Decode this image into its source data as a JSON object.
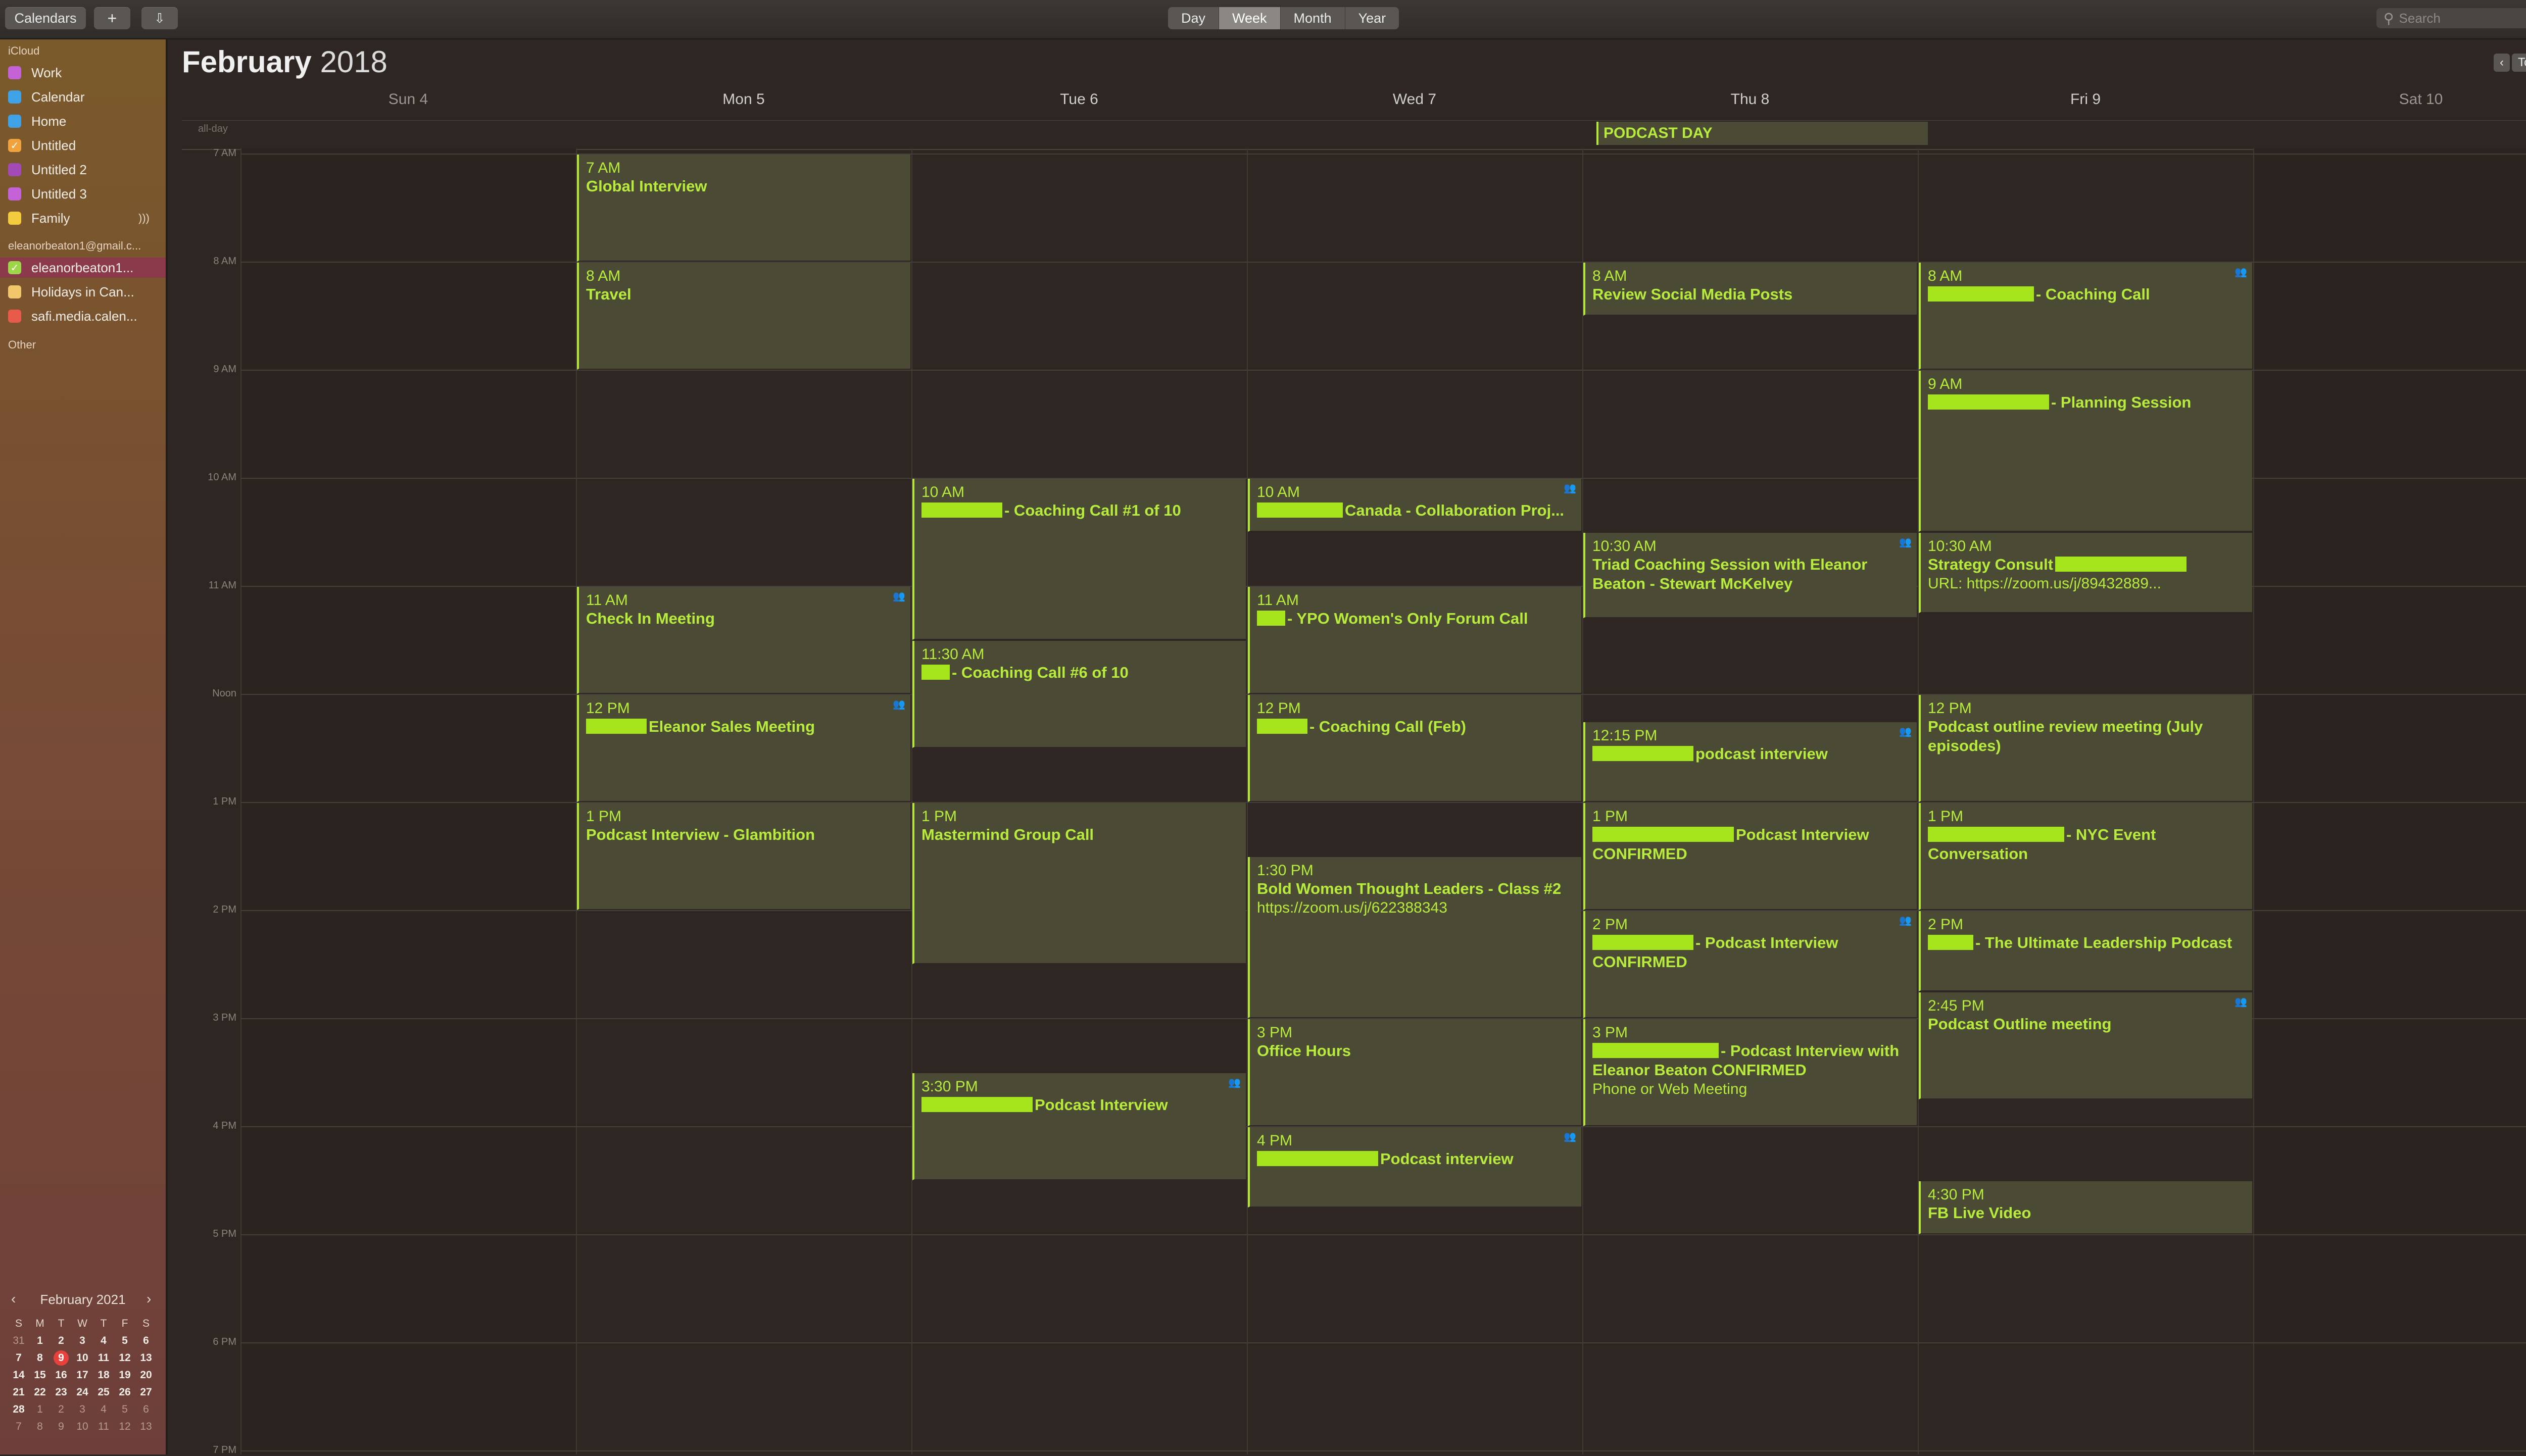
{
  "toolbar": {
    "calendars_label": "Calendars",
    "add_label": "+",
    "import_label": "⇩",
    "views": [
      "Day",
      "Week",
      "Month",
      "Year"
    ],
    "selected_view": "Week",
    "search_placeholder": "Search"
  },
  "sidebar": {
    "icloud_title": "iCloud",
    "icloud": [
      {
        "label": "Work",
        "color": "#c262d6"
      },
      {
        "label": "Calendar",
        "color": "#3fa2e6"
      },
      {
        "label": "Home",
        "color": "#3fa2e6"
      },
      {
        "label": "Untitled",
        "color": "#f0a23c",
        "checked": true
      },
      {
        "label": "Untitled 2",
        "color": "#a24ab6"
      },
      {
        "label": "Untitled 3",
        "color": "#c262d6"
      },
      {
        "label": "Family",
        "color": "#f2cc3c"
      }
    ],
    "gmail_title": "eleanorbeaton1@gmail.c...",
    "gmail": [
      {
        "label": "eleanorbeaton1...",
        "color": "#9ed64a",
        "checked": true,
        "selected": true
      },
      {
        "label": "Holidays in Can...",
        "color": "#f2c66a"
      },
      {
        "label": "safi.media.calen...",
        "color": "#e85a4a"
      }
    ],
    "other_title": "Other"
  },
  "mini_calendar": {
    "title": "February 2021",
    "prev": "‹",
    "next": "›",
    "dow": [
      "S",
      "M",
      "T",
      "W",
      "T",
      "F",
      "S"
    ],
    "days": [
      [
        "31",
        "1",
        "2",
        "3",
        "4",
        "5",
        "6"
      ],
      [
        "7",
        "8",
        "9",
        "10",
        "11",
        "12",
        "13"
      ],
      [
        "14",
        "15",
        "16",
        "17",
        "18",
        "19",
        "20"
      ],
      [
        "21",
        "22",
        "23",
        "24",
        "25",
        "26",
        "27"
      ],
      [
        "28",
        "1",
        "2",
        "3",
        "4",
        "5",
        "6"
      ],
      [
        "7",
        "8",
        "9",
        "10",
        "11",
        "12",
        "13"
      ]
    ],
    "today": "9"
  },
  "header": {
    "month": "February",
    "year": "2018",
    "prev": "‹",
    "today": "Today",
    "next": "›",
    "all_day_label": "all-day"
  },
  "days": [
    "Sun 4",
    "Mon 5",
    "Tue 6",
    "Wed 7",
    "Thu 8",
    "Fri 9",
    "Sat 10"
  ],
  "hours": [
    "7 AM",
    "8 AM",
    "9 AM",
    "10 AM",
    "11 AM",
    "Noon",
    "1 PM",
    "2 PM",
    "3 PM",
    "4 PM",
    "5 PM",
    "6 PM",
    "7 PM"
  ],
  "allday_event": "PODCAST DAY",
  "events": [
    {
      "day": 1,
      "start": 7,
      "end": 8,
      "time": "7 AM",
      "name": "Global Interview"
    },
    {
      "day": 1,
      "start": 8,
      "end": 9,
      "time": "8 AM",
      "name": "Travel"
    },
    {
      "day": 1,
      "start": 11,
      "end": 12,
      "time": "11 AM",
      "name": "Check In Meeting",
      "people": true
    },
    {
      "day": 1,
      "start": 12,
      "end": 13,
      "time": "12 PM",
      "redact": 120,
      "name": "Eleanor Sales Meeting",
      "people": true
    },
    {
      "day": 1,
      "start": 13,
      "end": 14,
      "time": "1 PM",
      "name": "Podcast Interview - Glambition"
    },
    {
      "day": 2,
      "start": 10,
      "end": 11.5,
      "time": "10 AM",
      "redact": 160,
      "name": "- Coaching Call #1 of 10"
    },
    {
      "day": 2,
      "start": 11.5,
      "end": 12.5,
      "time": "11:30 AM",
      "redact": 56,
      "name": "- Coaching Call #6 of 10"
    },
    {
      "day": 2,
      "start": 13,
      "end": 14.5,
      "time": "1 PM",
      "name": "Mastermind Group Call"
    },
    {
      "day": 2,
      "start": 15.5,
      "end": 16.5,
      "time": "3:30 PM",
      "redact": 220,
      "name": "Podcast Interview",
      "people": true
    },
    {
      "day": 3,
      "start": 10,
      "end": 10.5,
      "time": "10 AM",
      "redact": 170,
      "name": "Canada - Collaboration Proj...",
      "people": true
    },
    {
      "day": 3,
      "start": 11,
      "end": 12,
      "time": "11 AM",
      "redact": 56,
      "name": "- YPO Women's Only Forum Call"
    },
    {
      "day": 3,
      "start": 12,
      "end": 13,
      "time": "12 PM",
      "redact": 100,
      "name": "- Coaching Call (Feb)"
    },
    {
      "day": 3,
      "start": 13.5,
      "end": 15,
      "time": "1:30 PM",
      "name": "Bold Women Thought Leaders - Class #2",
      "detail": "https://zoom.us/j/622388343"
    },
    {
      "day": 3,
      "start": 15,
      "end": 16,
      "time": "3 PM",
      "name": "Office Hours"
    },
    {
      "day": 3,
      "start": 16,
      "end": 16.75,
      "time": "4 PM",
      "redact": 240,
      "name": "Podcast interview",
      "people": true
    },
    {
      "day": 4,
      "start": 8,
      "end": 8.5,
      "time": "8 AM",
      "name": "Review Social Media Posts"
    },
    {
      "day": 4,
      "start": 10.5,
      "end": 11.3,
      "time": "10:30 AM",
      "name": "Triad Coaching Session with Eleanor Beaton - Stewart McKelvey",
      "people": true
    },
    {
      "day": 4,
      "start": 12.25,
      "end": 13,
      "time": "12:15 PM",
      "redact": 200,
      "name": "podcast interview",
      "people": true
    },
    {
      "day": 4,
      "start": 13,
      "end": 14,
      "time": "1 PM",
      "redact": 280,
      "name": "Podcast Interview  CONFIRMED"
    },
    {
      "day": 4,
      "start": 14,
      "end": 15,
      "time": "2 PM",
      "redact": 200,
      "name": "- Podcast Interview CONFIRMED",
      "people": true
    },
    {
      "day": 4,
      "start": 15,
      "end": 16,
      "time": "3 PM",
      "redact": 250,
      "name": "- Podcast Interview with Eleanor Beaton CONFIRMED",
      "detail": "Phone or Web Meeting"
    },
    {
      "day": 5,
      "start": 8,
      "end": 9,
      "time": "8 AM",
      "redact": 210,
      "name": "- Coaching Call",
      "people": true
    },
    {
      "day": 5,
      "start": 9,
      "end": 10.5,
      "time": "9 AM",
      "redact": 240,
      "name": "- Planning Session"
    },
    {
      "day": 5,
      "start": 10.5,
      "end": 11.25,
      "time": "10:30 AM",
      "name": "Strategy Consult",
      "redact_after": 260,
      "detail": "URL: https://zoom.us/j/89432889..."
    },
    {
      "day": 5,
      "start": 12,
      "end": 13,
      "time": "12 PM",
      "name": "Podcast outline review meeting (July episodes)"
    },
    {
      "day": 5,
      "start": 13,
      "end": 14,
      "time": "1 PM",
      "redact": 270,
      "name": "- NYC Event Conversation"
    },
    {
      "day": 5,
      "start": 14,
      "end": 14.75,
      "time": "2 PM",
      "redact": 90,
      "name": "- The Ultimate Leadership Podcast"
    },
    {
      "day": 5,
      "start": 14.75,
      "end": 15.75,
      "time": "2:45 PM",
      "name": "Podcast Outline meeting",
      "people": true
    },
    {
      "day": 5,
      "start": 16.5,
      "end": 17,
      "time": "4:30 PM",
      "name": "FB Live Video"
    }
  ]
}
